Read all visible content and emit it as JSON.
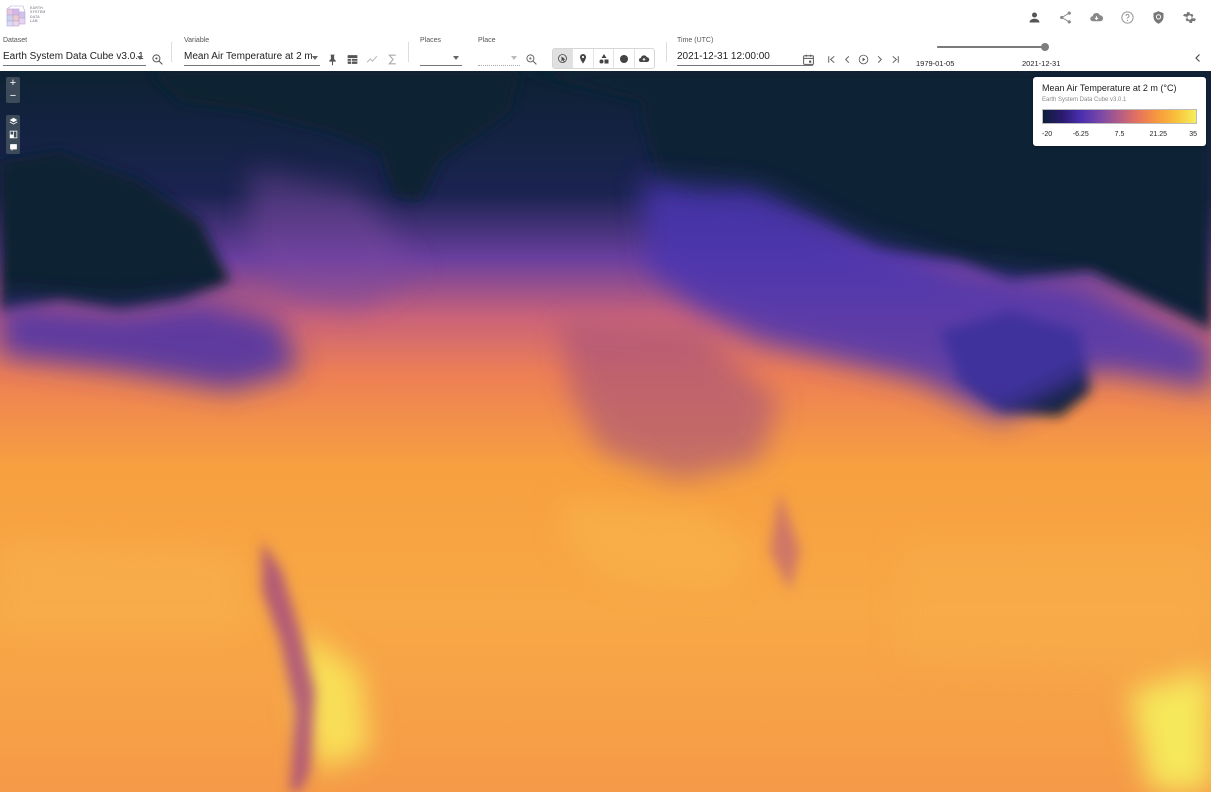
{
  "app": {
    "logo_text": [
      "EARTH",
      "SYSTEM",
      "DATA",
      "LAB"
    ],
    "top_icons": [
      "user-icon",
      "share-icon",
      "cloud-download-icon",
      "help-icon",
      "shield-icon",
      "settings-icon"
    ]
  },
  "controls": {
    "dataset": {
      "label": "Dataset",
      "value": "Earth System Data Cube v3.0.1"
    },
    "variable": {
      "label": "Variable",
      "value": "Mean Air Temperature at 2 m"
    },
    "places": {
      "label": "Places",
      "value": ""
    },
    "place": {
      "label": "Place",
      "value": ""
    },
    "time": {
      "label": "Time (UTC)",
      "value": "2021-12-31 12:00:00"
    },
    "time_range": {
      "start": "1979-01-05",
      "end": "2021-12-31",
      "position": 1.0
    },
    "mode_buttons": [
      "select-mode-icon",
      "point-mode-icon",
      "shapes-mode-icon",
      "circle-mode-icon",
      "upload-icon"
    ],
    "active_mode": 0
  },
  "legend": {
    "title": "Mean Air Temperature at 2 m (°C)",
    "subtitle": "Earth System Data Cube v3.0.1",
    "ticks": [
      "-20",
      "-6.25",
      "7.5",
      "21.25",
      "35"
    ],
    "colormap": [
      "#0d1f3a",
      "#2b1a6e",
      "#4a2fb0",
      "#7a48a8",
      "#b35c86",
      "#e8735c",
      "#f79a3c",
      "#f9c23c",
      "#f4f05a"
    ]
  },
  "map_controls": {
    "zoom_in": "+",
    "zoom_out": "−"
  },
  "colors": {
    "accent": "#3c4a5a",
    "map_warm": "#f7a44a",
    "map_cold": "#0d2233"
  }
}
